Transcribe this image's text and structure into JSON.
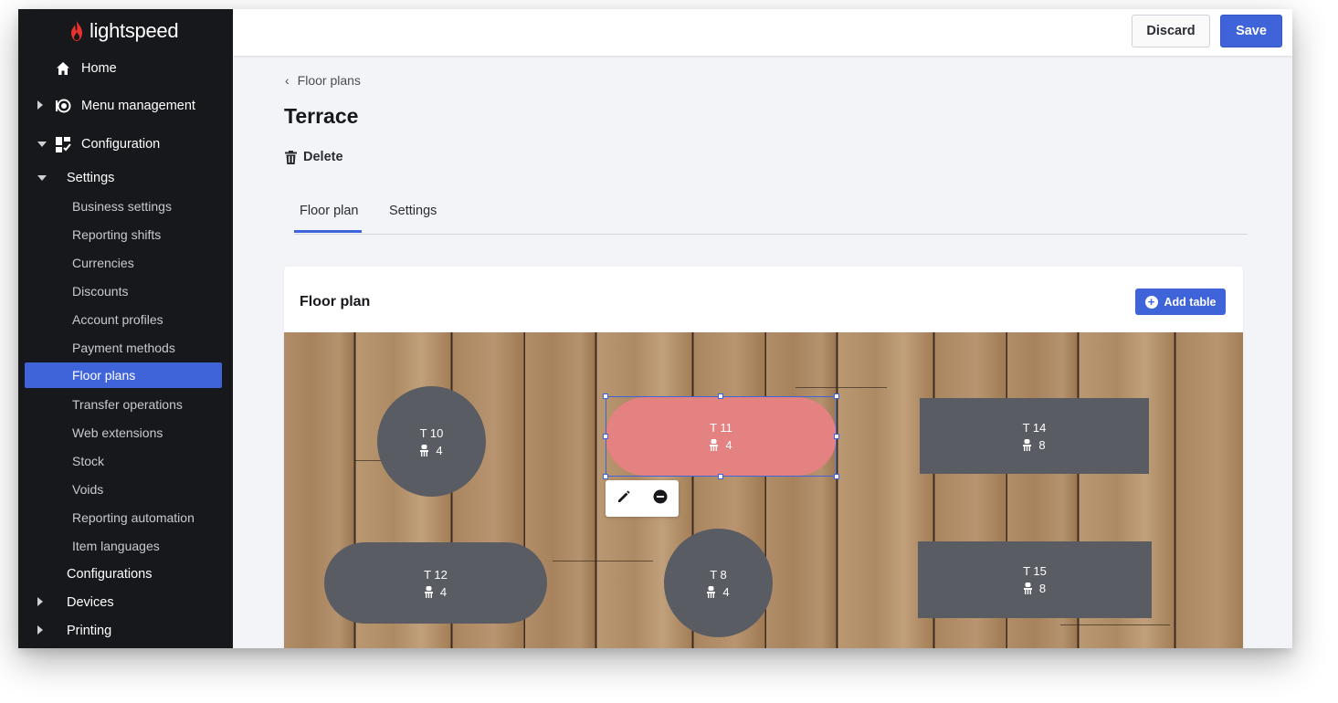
{
  "brand": {
    "name": "lightspeed",
    "accent": "#e8322b"
  },
  "sidebar": {
    "home": "Home",
    "menu_management": "Menu management",
    "configuration": "Configuration",
    "settings": "Settings",
    "settings_items": [
      "Business settings",
      "Reporting shifts",
      "Currencies",
      "Discounts",
      "Account profiles",
      "Payment methods",
      "Floor plans",
      "Transfer operations",
      "Web extensions",
      "Stock",
      "Voids",
      "Reporting automation",
      "Item languages"
    ],
    "active_item": "Floor plans",
    "configurations": "Configurations",
    "devices": "Devices",
    "printing": "Printing"
  },
  "topbar": {
    "discard_label": "Discard",
    "save_label": "Save"
  },
  "breadcrumb": {
    "label": "Floor plans"
  },
  "page": {
    "title": "Terrace",
    "delete_label": "Delete"
  },
  "tabs": [
    {
      "label": "Floor plan",
      "active": true
    },
    {
      "label": "Settings",
      "active": false
    }
  ],
  "card": {
    "title": "Floor plan",
    "add_table_label": "Add table"
  },
  "tables": [
    {
      "name": "T 10",
      "seats": "4",
      "shape": "round"
    },
    {
      "name": "T 11",
      "seats": "4",
      "shape": "pill",
      "selected": true
    },
    {
      "name": "T 14",
      "seats": "8",
      "shape": "rect"
    },
    {
      "name": "T 12",
      "seats": "4",
      "shape": "pill"
    },
    {
      "name": "T 8",
      "seats": "4",
      "shape": "round"
    },
    {
      "name": "T 15",
      "seats": "8",
      "shape": "rect"
    }
  ],
  "colors": {
    "primary": "#3f63d8",
    "table": "#5a5c63",
    "table_selected": "#e48181",
    "sidebar_bg": "#17181c"
  },
  "icons": {
    "edit": "pencil-icon",
    "remove": "minus-circle-icon",
    "seat": "chair-icon",
    "delete": "trash-icon",
    "add": "plus-circle-icon"
  }
}
